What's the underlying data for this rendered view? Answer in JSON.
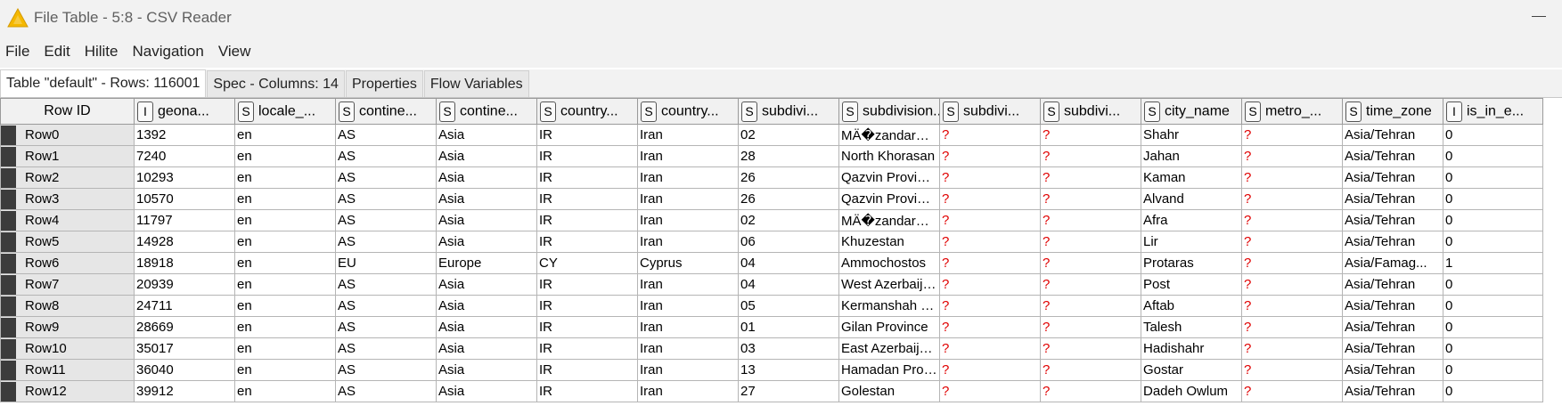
{
  "window": {
    "title": "File Table - 5:8 - CSV Reader"
  },
  "menu": [
    "File",
    "Edit",
    "Hilite",
    "Navigation",
    "View"
  ],
  "tabs": [
    "Table \"default\" - Rows: 116001",
    "Spec - Columns: 14",
    "Properties",
    "Flow Variables"
  ],
  "table": {
    "rowid_header": "Row ID",
    "columns": [
      {
        "type": "I",
        "label": "geona..."
      },
      {
        "type": "S",
        "label": "locale_..."
      },
      {
        "type": "S",
        "label": "contine..."
      },
      {
        "type": "S",
        "label": "contine..."
      },
      {
        "type": "S",
        "label": "country..."
      },
      {
        "type": "S",
        "label": "country..."
      },
      {
        "type": "S",
        "label": "subdivi..."
      },
      {
        "type": "S",
        "label": "subdivision..."
      },
      {
        "type": "S",
        "label": "subdivi..."
      },
      {
        "type": "S",
        "label": "subdivi..."
      },
      {
        "type": "S",
        "label": "city_name"
      },
      {
        "type": "S",
        "label": "metro_..."
      },
      {
        "type": "S",
        "label": "time_zone"
      },
      {
        "type": "I",
        "label": "is_in_e..."
      }
    ],
    "rows": [
      {
        "id": "Row0",
        "cells": [
          "1392",
          "en",
          "AS",
          "Asia",
          "IR",
          "Iran",
          "02",
          "MÄ�zandarÄ�n",
          "?",
          "?",
          "Shahr",
          "?",
          "Asia/Tehran",
          "0"
        ]
      },
      {
        "id": "Row1",
        "cells": [
          "7240",
          "en",
          "AS",
          "Asia",
          "IR",
          "Iran",
          "28",
          "North Khorasan",
          "?",
          "?",
          "Jahan",
          "?",
          "Asia/Tehran",
          "0"
        ]
      },
      {
        "id": "Row2",
        "cells": [
          "10293",
          "en",
          "AS",
          "Asia",
          "IR",
          "Iran",
          "26",
          "Qazvin Province",
          "?",
          "?",
          "Kaman",
          "?",
          "Asia/Tehran",
          "0"
        ]
      },
      {
        "id": "Row3",
        "cells": [
          "10570",
          "en",
          "AS",
          "Asia",
          "IR",
          "Iran",
          "26",
          "Qazvin Province",
          "?",
          "?",
          "Alvand",
          "?",
          "Asia/Tehran",
          "0"
        ]
      },
      {
        "id": "Row4",
        "cells": [
          "11797",
          "en",
          "AS",
          "Asia",
          "IR",
          "Iran",
          "02",
          "MÄ�zandarÄ�n",
          "?",
          "?",
          "Afra",
          "?",
          "Asia/Tehran",
          "0"
        ]
      },
      {
        "id": "Row5",
        "cells": [
          "14928",
          "en",
          "AS",
          "Asia",
          "IR",
          "Iran",
          "06",
          "Khuzestan",
          "?",
          "?",
          "Lir",
          "?",
          "Asia/Tehran",
          "0"
        ]
      },
      {
        "id": "Row6",
        "cells": [
          "18918",
          "en",
          "EU",
          "Europe",
          "CY",
          "Cyprus",
          "04",
          "Ammochostos",
          "?",
          "?",
          "Protaras",
          "?",
          "Asia/Famag...",
          "1"
        ]
      },
      {
        "id": "Row7",
        "cells": [
          "20939",
          "en",
          "AS",
          "Asia",
          "IR",
          "Iran",
          "04",
          "West Azerbaija...",
          "?",
          "?",
          "Post",
          "?",
          "Asia/Tehran",
          "0"
        ]
      },
      {
        "id": "Row8",
        "cells": [
          "24711",
          "en",
          "AS",
          "Asia",
          "IR",
          "Iran",
          "05",
          "Kermanshah Pr...",
          "?",
          "?",
          "Aftab",
          "?",
          "Asia/Tehran",
          "0"
        ]
      },
      {
        "id": "Row9",
        "cells": [
          "28669",
          "en",
          "AS",
          "Asia",
          "IR",
          "Iran",
          "01",
          "Gilan Province",
          "?",
          "?",
          "Talesh",
          "?",
          "Asia/Tehran",
          "0"
        ]
      },
      {
        "id": "Row10",
        "cells": [
          "35017",
          "en",
          "AS",
          "Asia",
          "IR",
          "Iran",
          "03",
          "East Azerbaijan...",
          "?",
          "?",
          "Hadishahr",
          "?",
          "Asia/Tehran",
          "0"
        ]
      },
      {
        "id": "Row11",
        "cells": [
          "36040",
          "en",
          "AS",
          "Asia",
          "IR",
          "Iran",
          "13",
          "Hamadan Provi...",
          "?",
          "?",
          "Gostar",
          "?",
          "Asia/Tehran",
          "0"
        ]
      },
      {
        "id": "Row12",
        "cells": [
          "39912",
          "en",
          "AS",
          "Asia",
          "IR",
          "Iran",
          "27",
          "Golestan",
          "?",
          "?",
          "Dadeh Owlum",
          "?",
          "Asia/Tehran",
          "0"
        ]
      }
    ]
  },
  "colors": {
    "missing": "#e00000",
    "icon_triangle": "#f5b800"
  }
}
